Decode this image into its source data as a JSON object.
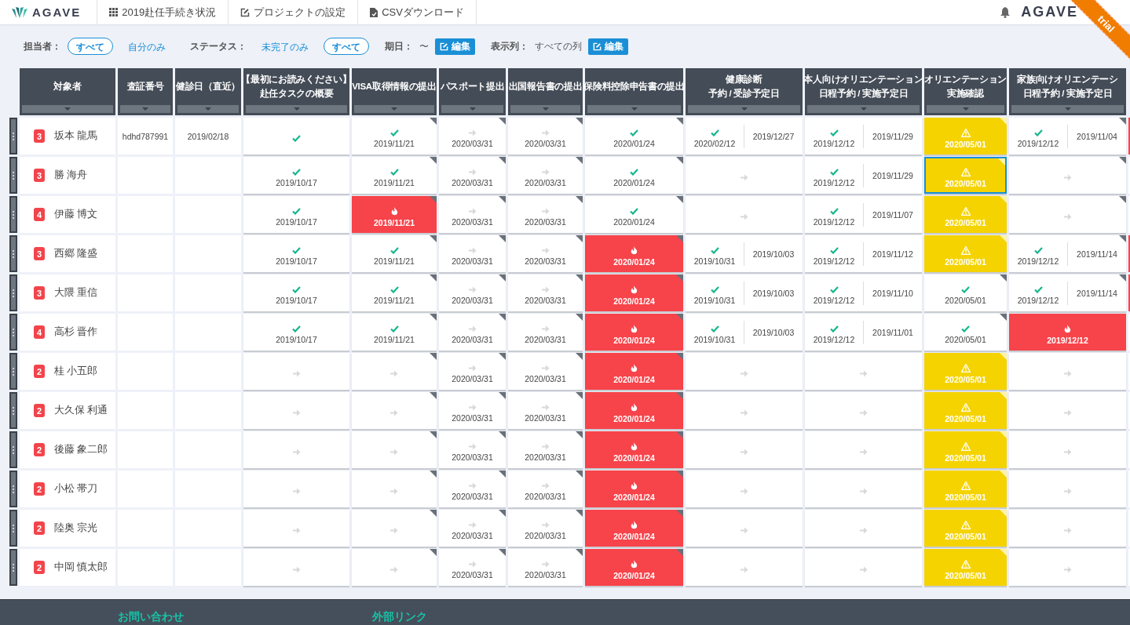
{
  "topbar": {
    "logo": "AGAVE",
    "tabs": [
      {
        "label": "2019赴任手続き状況"
      },
      {
        "label": "プロジェクトの設定"
      },
      {
        "label": "CSVダウンロード"
      }
    ],
    "right_logo": "AGAVE",
    "ribbon": "trial"
  },
  "filters": [
    {
      "kind": "options",
      "label": "担当者：",
      "options": [
        {
          "label": "すべて",
          "selected": true
        },
        {
          "label": "自分のみ",
          "selected": false
        }
      ]
    },
    {
      "kind": "options",
      "label": "ステータス：",
      "options": [
        {
          "label": "未完了のみ",
          "selected": false
        },
        {
          "label": "すべて",
          "selected": true
        }
      ]
    },
    {
      "kind": "edit",
      "label": "期日：",
      "value": "〜",
      "button": "編集"
    },
    {
      "kind": "edit",
      "label": "表示列：",
      "value": "すべての列",
      "button": "編集"
    }
  ],
  "columns": [
    [
      "対象者"
    ],
    [
      "査証番号"
    ],
    [
      "健診日（直近）"
    ],
    [
      "【最初にお読みください】",
      "赴任タスクの概要"
    ],
    [
      "VISA取得情報の提出"
    ],
    [
      "パスポート提出"
    ],
    [
      "出国報告書の提出"
    ],
    [
      "保険料控除申告書の提出"
    ],
    [
      "健康診断",
      "予約 / 受診予定日"
    ],
    [
      "本人向けオリエンテーション",
      "日程予約 / 実施予定日"
    ],
    [
      "オリエンテーション",
      "実施確認"
    ],
    [
      "家族向けオリエンテーシ",
      "日程予約 / 実施予定日"
    ]
  ],
  "rows": [
    {
      "count": "3",
      "name": "坂本 龍馬",
      "visa_no": "hdhd787991",
      "checkup": "2019/02/18",
      "edge_overdue": true,
      "tasks": [
        {
          "kind": "done",
          "flag": false,
          "selected": false
        },
        {
          "kind": "done",
          "date": "2019/11/21",
          "flag": true,
          "selected": false
        },
        {
          "kind": "pending",
          "date": "2020/03/31",
          "flag": true,
          "selected": false
        },
        {
          "kind": "pending",
          "date": "2020/03/31",
          "flag": true,
          "selected": false
        },
        {
          "kind": "done",
          "date": "2020/01/24",
          "flag": true,
          "selected": false
        },
        {
          "kind": "split",
          "date": "2020/02/12",
          "date2": "2019/12/27",
          "flag": false,
          "selected": false
        },
        {
          "kind": "split",
          "date": "2019/12/12",
          "date2": "2019/11/29",
          "flag": false,
          "selected": false
        },
        {
          "kind": "warning",
          "date": "2020/05/01",
          "flag": true,
          "selected": false
        },
        {
          "kind": "split",
          "date": "2019/12/12",
          "date2": "2019/11/04",
          "flag": true,
          "selected": false
        }
      ]
    },
    {
      "count": "3",
      "name": "勝 海舟",
      "edge_overdue": false,
      "tasks": [
        {
          "kind": "done",
          "date": "2019/10/17",
          "flag": false,
          "selected": false
        },
        {
          "kind": "done",
          "date": "2019/11/21",
          "flag": true,
          "selected": false
        },
        {
          "kind": "pending",
          "date": "2020/03/31",
          "flag": true,
          "selected": false
        },
        {
          "kind": "pending",
          "date": "2020/03/31",
          "flag": true,
          "selected": false
        },
        {
          "kind": "done",
          "date": "2020/01/24",
          "flag": true,
          "selected": false
        },
        {
          "kind": "pending",
          "flag": false,
          "selected": false
        },
        {
          "kind": "split",
          "date": "2019/12/12",
          "date2": "2019/11/29",
          "flag": false,
          "selected": false
        },
        {
          "kind": "warning",
          "date": "2020/05/01",
          "flag": true,
          "selected": true
        },
        {
          "kind": "pending",
          "flag": true,
          "selected": false
        }
      ]
    },
    {
      "count": "4",
      "name": "伊藤 博文",
      "edge_overdue": false,
      "tasks": [
        {
          "kind": "done",
          "date": "2019/10/17",
          "flag": false,
          "selected": false
        },
        {
          "kind": "overdue",
          "date": "2019/11/21",
          "flag": true,
          "selected": false
        },
        {
          "kind": "pending",
          "date": "2020/03/31",
          "flag": true,
          "selected": false
        },
        {
          "kind": "pending",
          "date": "2020/03/31",
          "flag": true,
          "selected": false
        },
        {
          "kind": "done",
          "date": "2020/01/24",
          "flag": true,
          "selected": false
        },
        {
          "kind": "pending",
          "flag": false,
          "selected": false
        },
        {
          "kind": "split",
          "date": "2019/12/12",
          "date2": "2019/11/07",
          "flag": false,
          "selected": false
        },
        {
          "kind": "warning",
          "date": "2020/05/01",
          "flag": true,
          "selected": false
        },
        {
          "kind": "pending",
          "flag": true,
          "selected": false
        }
      ]
    },
    {
      "count": "3",
      "name": "西郷 隆盛",
      "edge_overdue": true,
      "tasks": [
        {
          "kind": "done",
          "date": "2019/10/17",
          "flag": false,
          "selected": false
        },
        {
          "kind": "done",
          "date": "2019/11/21",
          "flag": true,
          "selected": false
        },
        {
          "kind": "pending",
          "date": "2020/03/31",
          "flag": true,
          "selected": false
        },
        {
          "kind": "pending",
          "date": "2020/03/31",
          "flag": true,
          "selected": false
        },
        {
          "kind": "overdue",
          "date": "2020/01/24",
          "flag": true,
          "selected": false
        },
        {
          "kind": "split",
          "date": "2019/10/31",
          "date2": "2019/10/03",
          "flag": false,
          "selected": false
        },
        {
          "kind": "split",
          "date": "2019/12/12",
          "date2": "2019/11/12",
          "flag": false,
          "selected": false
        },
        {
          "kind": "warning",
          "date": "2020/05/01",
          "flag": true,
          "selected": false
        },
        {
          "kind": "split",
          "date": "2019/12/12",
          "date2": "2019/11/14",
          "flag": true,
          "selected": false
        }
      ]
    },
    {
      "count": "3",
      "name": "大隈 重信",
      "edge_overdue": true,
      "tasks": [
        {
          "kind": "done",
          "date": "2019/10/17",
          "flag": false,
          "selected": false
        },
        {
          "kind": "done",
          "date": "2019/11/21",
          "flag": true,
          "selected": false
        },
        {
          "kind": "pending",
          "date": "2020/03/31",
          "flag": true,
          "selected": false
        },
        {
          "kind": "pending",
          "date": "2020/03/31",
          "flag": true,
          "selected": false
        },
        {
          "kind": "overdue",
          "date": "2020/01/24",
          "flag": true,
          "selected": false
        },
        {
          "kind": "split",
          "date": "2019/10/31",
          "date2": "2019/10/03",
          "flag": false,
          "selected": false
        },
        {
          "kind": "split",
          "date": "2019/12/12",
          "date2": "2019/11/10",
          "flag": false,
          "selected": false
        },
        {
          "kind": "done",
          "date": "2020/05/01",
          "flag": true,
          "selected": false
        },
        {
          "kind": "split",
          "date": "2019/12/12",
          "date2": "2019/11/14",
          "flag": true,
          "selected": false
        }
      ]
    },
    {
      "count": "4",
      "name": "高杉 晋作",
      "edge_overdue": false,
      "tasks": [
        {
          "kind": "done",
          "date": "2019/10/17",
          "flag": false,
          "selected": false
        },
        {
          "kind": "done",
          "date": "2019/11/21",
          "flag": true,
          "selected": false
        },
        {
          "kind": "pending",
          "date": "2020/03/31",
          "flag": true,
          "selected": false
        },
        {
          "kind": "pending",
          "date": "2020/03/31",
          "flag": true,
          "selected": false
        },
        {
          "kind": "overdue",
          "date": "2020/01/24",
          "flag": true,
          "selected": false
        },
        {
          "kind": "split",
          "date": "2019/10/31",
          "date2": "2019/10/03",
          "flag": false,
          "selected": false
        },
        {
          "kind": "split",
          "date": "2019/12/12",
          "date2": "2019/11/01",
          "flag": false,
          "selected": false
        },
        {
          "kind": "done",
          "date": "2020/05/01",
          "flag": true,
          "selected": false
        },
        {
          "kind": "overdue",
          "date": "2019/12/12",
          "flag": false,
          "selected": false
        }
      ]
    },
    {
      "count": "2",
      "name": "桂 小五郎",
      "edge_overdue": false,
      "tasks": [
        {
          "kind": "pending",
          "flag": false,
          "selected": false
        },
        {
          "kind": "pending",
          "flag": true,
          "selected": false
        },
        {
          "kind": "pending",
          "date": "2020/03/31",
          "flag": true,
          "selected": false
        },
        {
          "kind": "pending",
          "date": "2020/03/31",
          "flag": true,
          "selected": false
        },
        {
          "kind": "overdue",
          "date": "2020/01/24",
          "flag": true,
          "selected": false
        },
        {
          "kind": "pending",
          "flag": false,
          "selected": false
        },
        {
          "kind": "pending",
          "flag": false,
          "selected": false
        },
        {
          "kind": "warning",
          "date": "2020/05/01",
          "flag": true,
          "selected": false
        },
        {
          "kind": "pending",
          "flag": false,
          "selected": false
        }
      ]
    },
    {
      "count": "2",
      "name": "大久保 利通",
      "edge_overdue": false,
      "tasks": [
        {
          "kind": "pending",
          "flag": false,
          "selected": false
        },
        {
          "kind": "pending",
          "flag": true,
          "selected": false
        },
        {
          "kind": "pending",
          "date": "2020/03/31",
          "flag": true,
          "selected": false
        },
        {
          "kind": "pending",
          "date": "2020/03/31",
          "flag": true,
          "selected": false
        },
        {
          "kind": "overdue",
          "date": "2020/01/24",
          "flag": true,
          "selected": false
        },
        {
          "kind": "pending",
          "flag": false,
          "selected": false
        },
        {
          "kind": "pending",
          "flag": false,
          "selected": false
        },
        {
          "kind": "warning",
          "date": "2020/05/01",
          "flag": true,
          "selected": false
        },
        {
          "kind": "pending",
          "flag": false,
          "selected": false
        }
      ]
    },
    {
      "count": "2",
      "name": "後藤 象二郎",
      "edge_overdue": false,
      "tasks": [
        {
          "kind": "pending",
          "flag": false,
          "selected": false
        },
        {
          "kind": "pending",
          "flag": true,
          "selected": false
        },
        {
          "kind": "pending",
          "date": "2020/03/31",
          "flag": true,
          "selected": false
        },
        {
          "kind": "pending",
          "date": "2020/03/31",
          "flag": true,
          "selected": false
        },
        {
          "kind": "overdue",
          "date": "2020/01/24",
          "flag": true,
          "selected": false
        },
        {
          "kind": "pending",
          "flag": false,
          "selected": false
        },
        {
          "kind": "pending",
          "flag": false,
          "selected": false
        },
        {
          "kind": "warning",
          "date": "2020/05/01",
          "flag": true,
          "selected": false
        },
        {
          "kind": "pending",
          "flag": false,
          "selected": false
        }
      ]
    },
    {
      "count": "2",
      "name": "小松 帯刀",
      "edge_overdue": false,
      "tasks": [
        {
          "kind": "pending",
          "flag": false,
          "selected": false
        },
        {
          "kind": "pending",
          "flag": true,
          "selected": false
        },
        {
          "kind": "pending",
          "date": "2020/03/31",
          "flag": true,
          "selected": false
        },
        {
          "kind": "pending",
          "date": "2020/03/31",
          "flag": true,
          "selected": false
        },
        {
          "kind": "overdue",
          "date": "2020/01/24",
          "flag": true,
          "selected": false
        },
        {
          "kind": "pending",
          "flag": false,
          "selected": false
        },
        {
          "kind": "pending",
          "flag": false,
          "selected": false
        },
        {
          "kind": "warning",
          "date": "2020/05/01",
          "flag": true,
          "selected": false
        },
        {
          "kind": "pending",
          "flag": false,
          "selected": false
        }
      ]
    },
    {
      "count": "2",
      "name": "陸奥 宗光",
      "edge_overdue": false,
      "tasks": [
        {
          "kind": "pending",
          "flag": false,
          "selected": false
        },
        {
          "kind": "pending",
          "flag": true,
          "selected": false
        },
        {
          "kind": "pending",
          "date": "2020/03/31",
          "flag": true,
          "selected": false
        },
        {
          "kind": "pending",
          "date": "2020/03/31",
          "flag": true,
          "selected": false
        },
        {
          "kind": "overdue",
          "date": "2020/01/24",
          "flag": true,
          "selected": false
        },
        {
          "kind": "pending",
          "flag": false,
          "selected": false
        },
        {
          "kind": "pending",
          "flag": false,
          "selected": false
        },
        {
          "kind": "warning",
          "date": "2020/05/01",
          "flag": true,
          "selected": false
        },
        {
          "kind": "pending",
          "flag": false,
          "selected": false
        }
      ]
    },
    {
      "count": "2",
      "name": "中岡 慎太郎",
      "edge_overdue": false,
      "tasks": [
        {
          "kind": "pending",
          "flag": false,
          "selected": false
        },
        {
          "kind": "pending",
          "flag": true,
          "selected": false
        },
        {
          "kind": "pending",
          "date": "2020/03/31",
          "flag": true,
          "selected": false
        },
        {
          "kind": "pending",
          "date": "2020/03/31",
          "flag": true,
          "selected": false
        },
        {
          "kind": "overdue",
          "date": "2020/01/24",
          "flag": true,
          "selected": false
        },
        {
          "kind": "pending",
          "flag": false,
          "selected": false
        },
        {
          "kind": "pending",
          "flag": false,
          "selected": false
        },
        {
          "kind": "warning",
          "date": "2020/05/01",
          "flag": true,
          "selected": false
        },
        {
          "kind": "pending",
          "flag": false,
          "selected": false
        }
      ]
    }
  ],
  "footer": {
    "headings": [
      "お問い合わせ",
      "外部リンク"
    ]
  }
}
